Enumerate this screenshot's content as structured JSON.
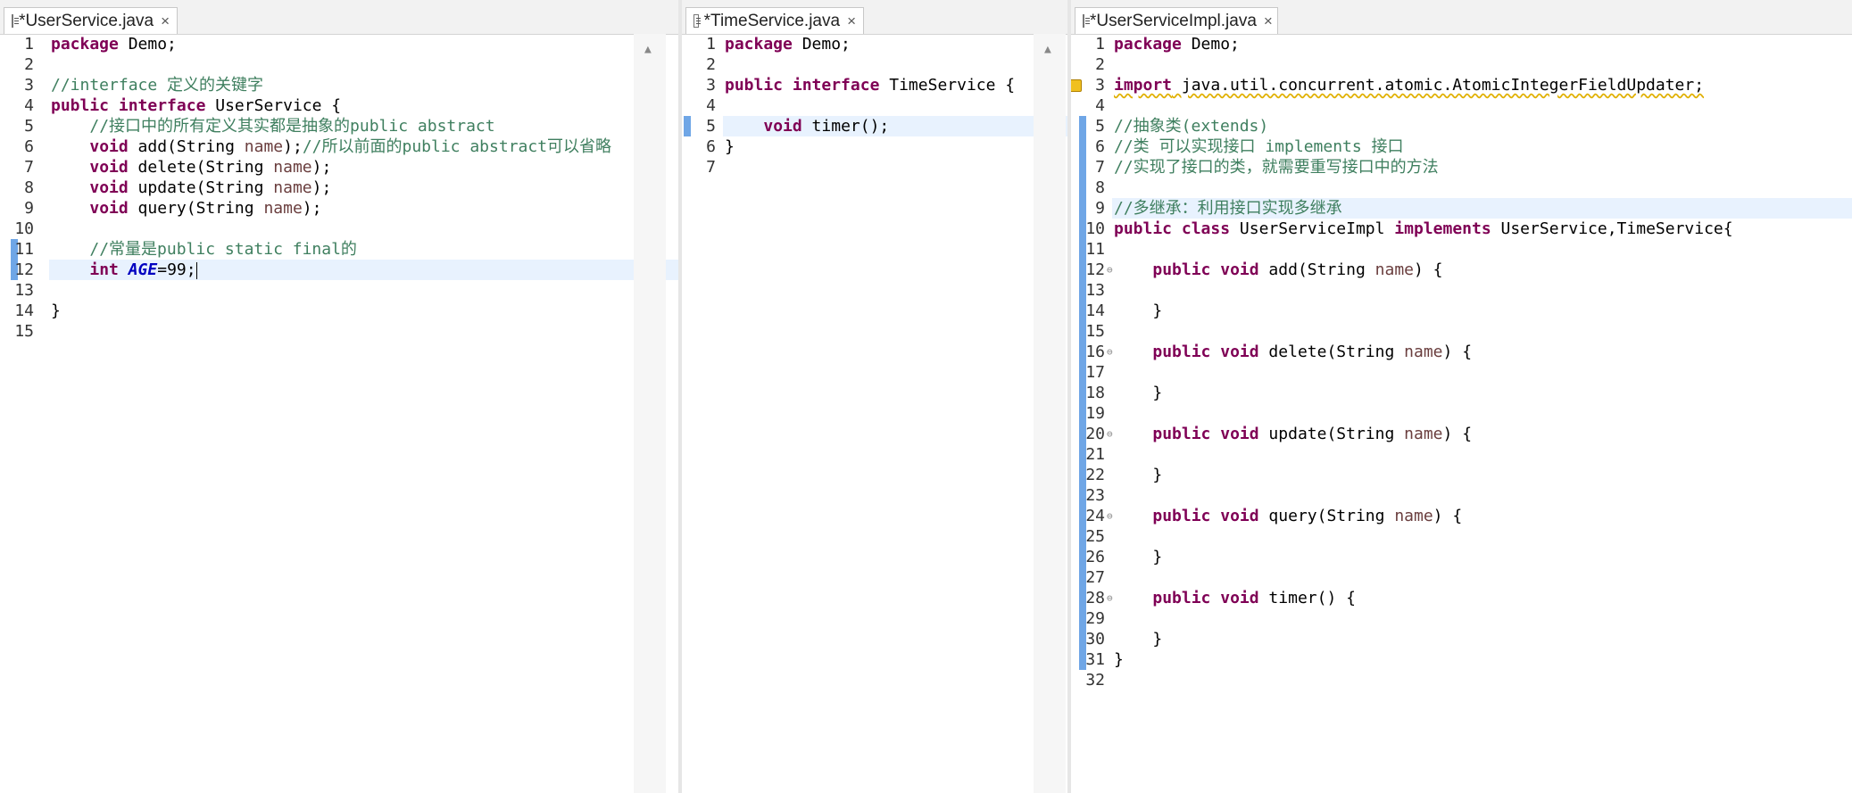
{
  "editors": [
    {
      "tab_title": "*UserService.java",
      "close_glyph": "×",
      "lines": [
        {
          "n": "1",
          "t": "package Demo;"
        },
        {
          "n": "2",
          "t": ""
        },
        {
          "n": "3",
          "t": "//interface 定义的关键字"
        },
        {
          "n": "4",
          "t": "public interface UserService {"
        },
        {
          "n": "5",
          "t": "    //接口中的所有定义其实都是抽象的public abstract"
        },
        {
          "n": "6",
          "t": "    void add(String name);//所以前面的public abstract可以省略"
        },
        {
          "n": "7",
          "t": "    void delete(String name);"
        },
        {
          "n": "8",
          "t": "    void update(String name);"
        },
        {
          "n": "9",
          "t": "    void query(String name);"
        },
        {
          "n": "10",
          "t": ""
        },
        {
          "n": "11",
          "t": "    //常量是public static final的"
        },
        {
          "n": "12",
          "t": "    int AGE=99;"
        },
        {
          "n": "13",
          "t": ""
        },
        {
          "n": "14",
          "t": "}"
        },
        {
          "n": "15",
          "t": ""
        }
      ]
    },
    {
      "tab_title": "*TimeService.java",
      "close_glyph": "×",
      "lines": [
        {
          "n": "1",
          "t": "package Demo;"
        },
        {
          "n": "2",
          "t": ""
        },
        {
          "n": "3",
          "t": "public interface TimeService {"
        },
        {
          "n": "4",
          "t": ""
        },
        {
          "n": "5",
          "t": "    void timer();"
        },
        {
          "n": "6",
          "t": "}"
        },
        {
          "n": "7",
          "t": ""
        }
      ]
    },
    {
      "tab_title": "*UserServiceImpl.java",
      "close_glyph": "×",
      "lines": [
        {
          "n": "1",
          "t": "package Demo;"
        },
        {
          "n": "2",
          "t": ""
        },
        {
          "n": "3",
          "t": "import java.util.concurrent.atomic.AtomicIntegerFieldUpdater;"
        },
        {
          "n": "4",
          "t": ""
        },
        {
          "n": "5",
          "t": "//抽象类(extends)"
        },
        {
          "n": "6",
          "t": "//类 可以实现接口 implements 接口"
        },
        {
          "n": "7",
          "t": "//实现了接口的类，就需要重写接口中的方法"
        },
        {
          "n": "8",
          "t": ""
        },
        {
          "n": "9",
          "t": "//多继承：利用接口实现多继承"
        },
        {
          "n": "10",
          "t": "public class UserServiceImpl implements UserService,TimeService{"
        },
        {
          "n": "11",
          "t": ""
        },
        {
          "n": "12",
          "t": "    public void add(String name) {"
        },
        {
          "n": "13",
          "t": ""
        },
        {
          "n": "14",
          "t": "    }"
        },
        {
          "n": "15",
          "t": ""
        },
        {
          "n": "16",
          "t": "    public void delete(String name) {"
        },
        {
          "n": "17",
          "t": ""
        },
        {
          "n": "18",
          "t": "    }"
        },
        {
          "n": "19",
          "t": ""
        },
        {
          "n": "20",
          "t": "    public void update(String name) {"
        },
        {
          "n": "21",
          "t": ""
        },
        {
          "n": "22",
          "t": "    }"
        },
        {
          "n": "23",
          "t": ""
        },
        {
          "n": "24",
          "t": "    public void query(String name) {"
        },
        {
          "n": "25",
          "t": ""
        },
        {
          "n": "26",
          "t": "    }"
        },
        {
          "n": "27",
          "t": ""
        },
        {
          "n": "28",
          "t": "    public void timer() {"
        },
        {
          "n": "29",
          "t": ""
        },
        {
          "n": "30",
          "t": "    }"
        },
        {
          "n": "31",
          "t": "}"
        },
        {
          "n": "32",
          "t": ""
        }
      ]
    }
  ],
  "icons": {
    "file": "java-file-icon",
    "close": "close-icon",
    "scroll_up": "scroll-up-arrow-icon",
    "warning": "import-warning-icon",
    "fold": "fold-collapse-icon"
  },
  "colors": {
    "keyword": "#7f0055",
    "comment": "#3f7f5f",
    "parameter": "#6a3e3e",
    "constant": "#0000c0",
    "current_line": "#e8f2fe",
    "change_bar": "#6fa6e6"
  }
}
